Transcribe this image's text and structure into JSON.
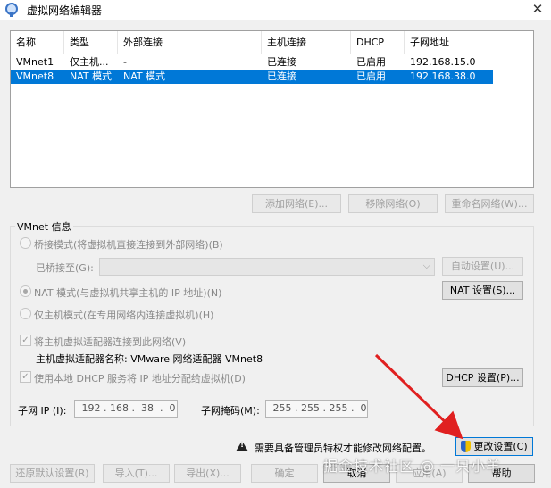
{
  "window": {
    "title": "虚拟网络编辑器",
    "close": "✕"
  },
  "table": {
    "columns": [
      "名称",
      "类型",
      "外部连接",
      "主机连接",
      "DHCP",
      "子网地址"
    ],
    "rows": [
      {
        "name": "VMnet1",
        "type": "仅主机...",
        "external": "-",
        "host": "已连接",
        "dhcp": "已启用",
        "subnet": "192.168.15.0",
        "selected": false
      },
      {
        "name": "VMnet8",
        "type": "NAT 模式",
        "external": "NAT 模式",
        "host": "已连接",
        "dhcp": "已启用",
        "subnet": "192.168.38.0",
        "selected": true
      }
    ]
  },
  "table_buttons": {
    "add": "添加网络(E)...",
    "remove": "移除网络(O)",
    "rename": "重命名网络(W)..."
  },
  "vmnet_info": {
    "group_title": "VMnet 信息",
    "bridged_label": "桥接模式(将虚拟机直接连接到外部网络)(B)",
    "bridged_to_label": "已桥接至(G):",
    "bridged_to_value": "",
    "auto_settings": "自动设置(U)...",
    "nat_label": "NAT 模式(与虚拟机共享主机的 IP 地址)(N)",
    "nat_settings": "NAT 设置(S)...",
    "hostonly_label": "仅主机模式(在专用网络内连接虚拟机)(H)",
    "connect_adapter_label": "将主机虚拟适配器连接到此网络(V)",
    "adapter_name_label": "主机虚拟适配器名称: VMware 网络适配器 VMnet8",
    "dhcp_label": "使用本地 DHCP 服务将 IP 地址分配给虚拟机(D)",
    "dhcp_settings": "DHCP 设置(P)...",
    "subnet_ip_label": "子网 IP (I):",
    "subnet_ip_value": " 192 . 168 .  38  .  0",
    "subnet_mask_label": "子网掩码(M):",
    "subnet_mask_value": " 255 . 255 . 255 .  0"
  },
  "footer": {
    "warning": "需要具备管理员特权才能修改网络配置。",
    "change_settings": "更改设置(C)",
    "restore_defaults": "还原默认设置(R)",
    "import": "导入(T)...",
    "export": "导出(X)...",
    "ok": "确定",
    "cancel": "取消",
    "apply": "应用(A)",
    "help": "帮助"
  },
  "watermark": "掘金技术社区 @ 一只小羊",
  "colors": {
    "selection": "#0078d7",
    "annotation_arrow": "#e02020"
  }
}
